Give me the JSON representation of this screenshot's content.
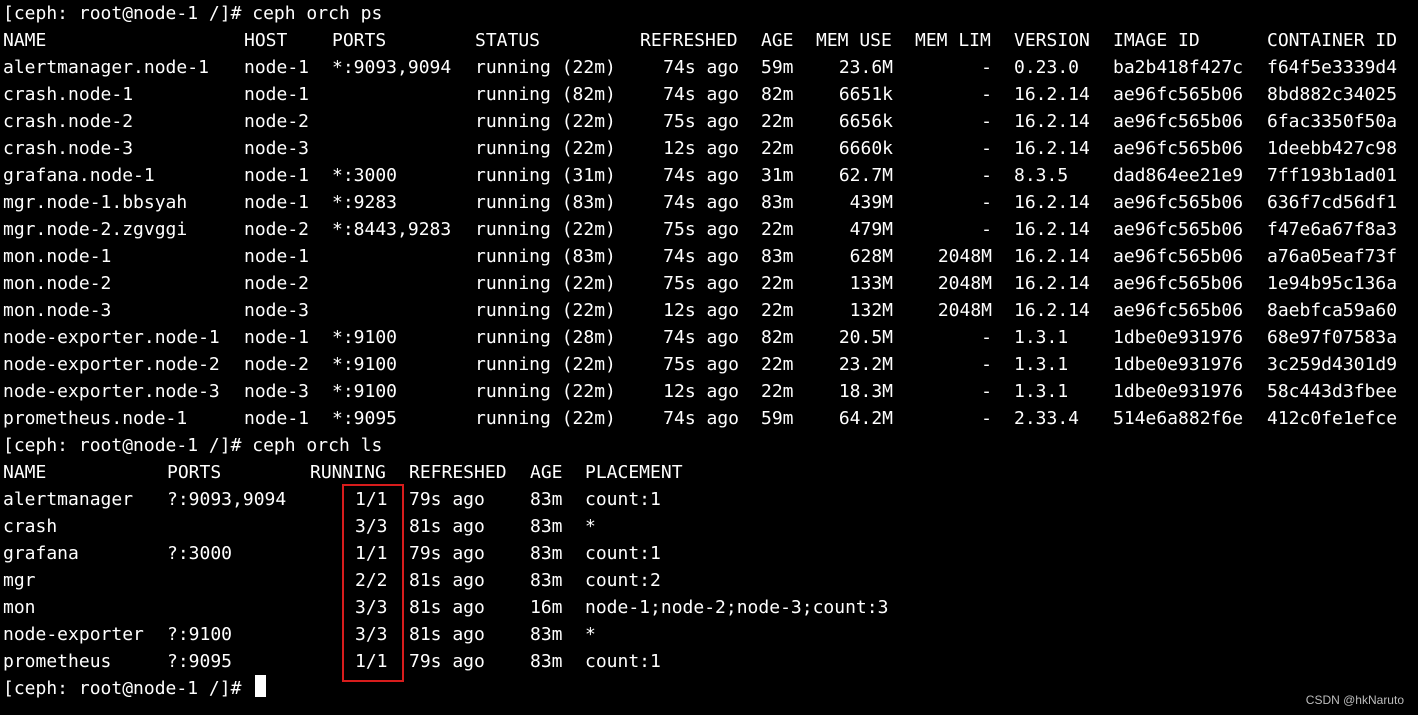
{
  "terminal": {
    "prompt1": "[ceph: root@node-1 /]# ceph orch ps",
    "prompt2": "[ceph: root@node-1 /]# ceph orch ls",
    "prompt3": "[ceph: root@node-1 /]# "
  },
  "ps": {
    "headers": [
      "NAME",
      "HOST",
      "PORTS",
      "STATUS",
      "REFRESHED",
      "AGE",
      "MEM USE",
      "MEM LIM",
      "VERSION",
      "IMAGE ID",
      "CONTAINER ID"
    ],
    "rows": [
      [
        "alertmanager.node-1",
        "node-1",
        "*:9093,9094",
        "running (22m)",
        "74s ago",
        "59m",
        "23.6M",
        "-",
        "0.23.0",
        "ba2b418f427c",
        "f64f5e3339d4"
      ],
      [
        "crash.node-1",
        "node-1",
        "",
        "running (82m)",
        "74s ago",
        "82m",
        "6651k",
        "-",
        "16.2.14",
        "ae96fc565b06",
        "8bd882c34025"
      ],
      [
        "crash.node-2",
        "node-2",
        "",
        "running (22m)",
        "75s ago",
        "22m",
        "6656k",
        "-",
        "16.2.14",
        "ae96fc565b06",
        "6fac3350f50a"
      ],
      [
        "crash.node-3",
        "node-3",
        "",
        "running (22m)",
        "12s ago",
        "22m",
        "6660k",
        "-",
        "16.2.14",
        "ae96fc565b06",
        "1deebb427c98"
      ],
      [
        "grafana.node-1",
        "node-1",
        "*:3000",
        "running (31m)",
        "74s ago",
        "31m",
        "62.7M",
        "-",
        "8.3.5",
        "dad864ee21e9",
        "7ff193b1ad01"
      ],
      [
        "mgr.node-1.bbsyah",
        "node-1",
        "*:9283",
        "running (83m)",
        "74s ago",
        "83m",
        "439M",
        "-",
        "16.2.14",
        "ae96fc565b06",
        "636f7cd56df1"
      ],
      [
        "mgr.node-2.zgvggi",
        "node-2",
        "*:8443,9283",
        "running (22m)",
        "75s ago",
        "22m",
        "479M",
        "-",
        "16.2.14",
        "ae96fc565b06",
        "f47e6a67f8a3"
      ],
      [
        "mon.node-1",
        "node-1",
        "",
        "running (83m)",
        "74s ago",
        "83m",
        "628M",
        "2048M",
        "16.2.14",
        "ae96fc565b06",
        "a76a05eaf73f"
      ],
      [
        "mon.node-2",
        "node-2",
        "",
        "running (22m)",
        "75s ago",
        "22m",
        "133M",
        "2048M",
        "16.2.14",
        "ae96fc565b06",
        "1e94b95c136a"
      ],
      [
        "mon.node-3",
        "node-3",
        "",
        "running (22m)",
        "12s ago",
        "22m",
        "132M",
        "2048M",
        "16.2.14",
        "ae96fc565b06",
        "8aebfca59a60"
      ],
      [
        "node-exporter.node-1",
        "node-1",
        "*:9100",
        "running (28m)",
        "74s ago",
        "82m",
        "20.5M",
        "-",
        "1.3.1",
        "1dbe0e931976",
        "68e97f07583a"
      ],
      [
        "node-exporter.node-2",
        "node-2",
        "*:9100",
        "running (22m)",
        "75s ago",
        "22m",
        "23.2M",
        "-",
        "1.3.1",
        "1dbe0e931976",
        "3c259d4301d9"
      ],
      [
        "node-exporter.node-3",
        "node-3",
        "*:9100",
        "running (22m)",
        "12s ago",
        "22m",
        "18.3M",
        "-",
        "1.3.1",
        "1dbe0e931976",
        "58c443d3fbee"
      ],
      [
        "prometheus.node-1",
        "node-1",
        "*:9095",
        "running (22m)",
        "74s ago",
        "59m",
        "64.2M",
        "-",
        "2.33.4",
        "514e6a882f6e",
        "412c0fe1efce"
      ]
    ]
  },
  "ls": {
    "headers": [
      "NAME",
      "PORTS",
      "RUNNING",
      "REFRESHED",
      "AGE",
      "PLACEMENT"
    ],
    "rows": [
      [
        "alertmanager",
        "?:9093,9094",
        "1/1",
        "79s ago",
        "83m",
        "count:1"
      ],
      [
        "crash",
        "",
        "3/3",
        "81s ago",
        "83m",
        "*"
      ],
      [
        "grafana",
        "?:3000",
        "1/1",
        "79s ago",
        "83m",
        "count:1"
      ],
      [
        "mgr",
        "",
        "2/2",
        "81s ago",
        "83m",
        "count:2"
      ],
      [
        "mon",
        "",
        "3/3",
        "81s ago",
        "16m",
        "node-1;node-2;node-3;count:3"
      ],
      [
        "node-exporter",
        "?:9100",
        "3/3",
        "81s ago",
        "83m",
        "*"
      ],
      [
        "prometheus",
        "?:9095",
        "1/1",
        "79s ago",
        "83m",
        "count:1"
      ]
    ]
  },
  "highlight_color": "#d71c1c",
  "watermark": "CSDN @hkNaruto"
}
